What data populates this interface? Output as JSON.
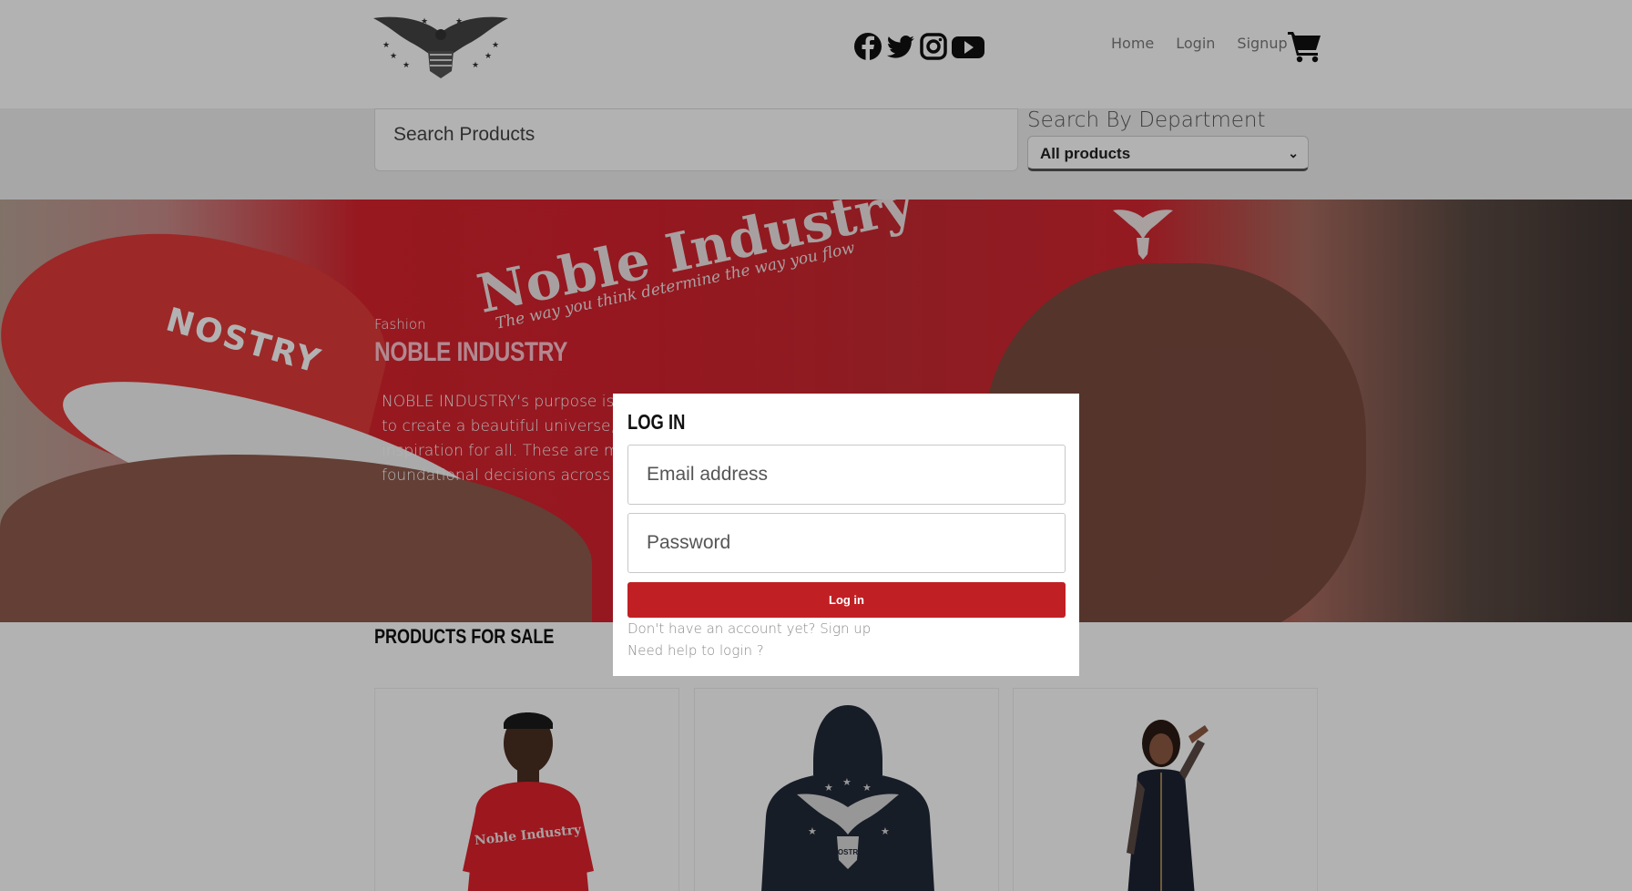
{
  "header": {
    "logo_icon": "eagle-crest-logo",
    "social_icons": [
      "facebook-icon",
      "twitter-icon",
      "instagram-icon",
      "youtube-icon"
    ],
    "nav": {
      "home": "Home",
      "login": "Login",
      "signup": "Signup"
    },
    "cart_icon": "shopping-cart-icon"
  },
  "search": {
    "placeholder": "Search Products",
    "department_label": "Search By Department",
    "department_selected": "All products"
  },
  "hero": {
    "eyebrow": "Fashion",
    "title": "NOBLE INDUSTRY",
    "description_lines": [
      "NOBLE INDUSTRY's purpose is to",
      "to create a beautiful universe, equa",
      "inspiration for all. These are more t",
      "foundational decisions across ever"
    ],
    "shirt_text": "Noble Industry",
    "shirt_subtext": "The way you think determine the way you flow",
    "cap_text": "NOSTRY"
  },
  "products": {
    "title": "PRODUCTS FOR SALE",
    "items": [
      {
        "name": "red-tshirt-product",
        "shirt_text": "Noble Industry"
      },
      {
        "name": "navy-hoodie-product",
        "hoodie_text": "NOSTRA"
      },
      {
        "name": "printed-dress-product"
      }
    ]
  },
  "modal": {
    "title": "LOG IN",
    "email_placeholder": "Email address",
    "password_placeholder": "Password",
    "login_button": "Log in",
    "signup_link": "Don't have an account yet? Sign up",
    "help_link": "Need help to login ?"
  },
  "colors": {
    "brand_red": "#c02024",
    "overlay": "rgba(0,0,0,0.3)"
  }
}
